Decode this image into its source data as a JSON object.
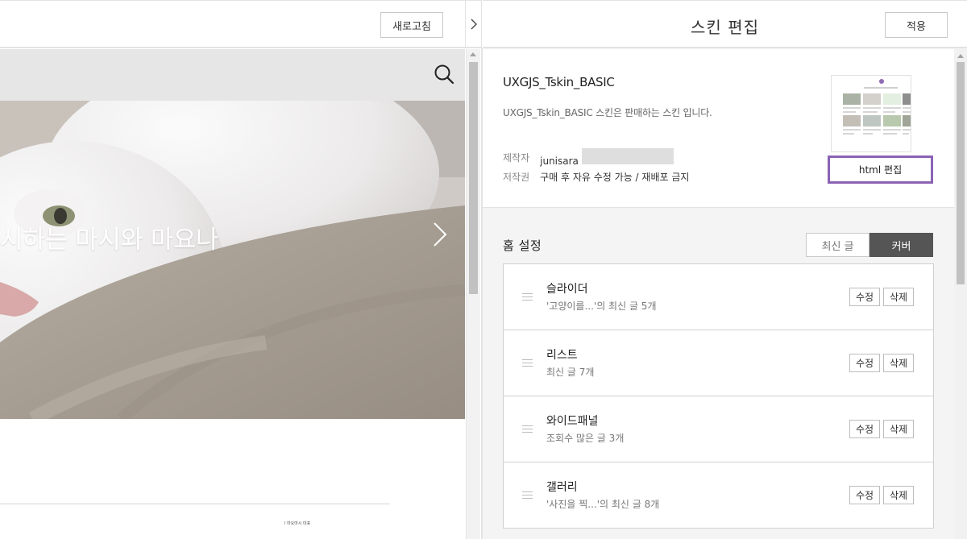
{
  "preview": {
    "refresh_label": "새로고침",
    "hero_title": "시하는 마시와 마요나",
    "tiny_text": "Ι 마요마시 대표"
  },
  "editor": {
    "title": "스킨 편집",
    "apply_label": "적용",
    "skin": {
      "name": "UXGJS_Tskin_BASIC",
      "description": "UXGJS_Tskin_BASIC 스킨은 판매하는 스킨 입니다.",
      "author_label": "제작자",
      "author": "junisara",
      "copyright_label": "저작권",
      "copyright": "구매 후 자유 수정 가능 / 재배포 금지",
      "html_edit_label": "html 편집"
    },
    "home": {
      "title": "홈 설정",
      "tabs": [
        "최신 글",
        "커버"
      ],
      "active_tab": "커버",
      "items": [
        {
          "title": "슬라이더",
          "subtitle": "'고양이를...'의 최신 글 5개",
          "edit": "수정",
          "delete": "삭제"
        },
        {
          "title": "리스트",
          "subtitle": "최신 글 7개",
          "edit": "수정",
          "delete": "삭제"
        },
        {
          "title": "와이드패널",
          "subtitle": "조회수 많은 글 3개",
          "edit": "수정",
          "delete": "삭제"
        },
        {
          "title": "갤러리",
          "subtitle": "'사진을 찍...'의 최신 글 8개",
          "edit": "수정",
          "delete": "삭제"
        }
      ]
    }
  },
  "colors": {
    "accent": "#8b63b5",
    "active_tab_bg": "#555555"
  },
  "icons": {
    "search": "search-icon",
    "hero_next": "chevron-right-icon",
    "collapse": "chevron-right-icon",
    "drag": "drag-handle-icon"
  }
}
